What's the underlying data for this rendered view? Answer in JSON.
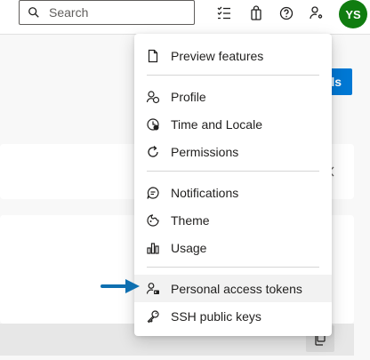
{
  "header": {
    "search_placeholder": "Search",
    "avatar_initials": "YS",
    "avatar_color": "#107c10",
    "icons": [
      "search-icon",
      "task-list-icon",
      "marketplace-bag-icon",
      "help-icon",
      "user-settings-icon"
    ]
  },
  "background": {
    "primary_button_label": "ls",
    "accent_color": "#0078d4"
  },
  "menu": {
    "items": [
      {
        "label": "Preview features",
        "icon": "preview-features-icon"
      },
      {
        "label": "Profile",
        "icon": "profile-icon"
      },
      {
        "label": "Time and Locale",
        "icon": "time-locale-icon"
      },
      {
        "label": "Permissions",
        "icon": "permissions-icon"
      },
      {
        "label": "Notifications",
        "icon": "notifications-icon"
      },
      {
        "label": "Theme",
        "icon": "theme-icon"
      },
      {
        "label": "Usage",
        "icon": "usage-icon"
      },
      {
        "label": "Personal access tokens",
        "icon": "personal-access-tokens-icon"
      },
      {
        "label": "SSH public keys",
        "icon": "ssh-keys-icon"
      }
    ],
    "highlighted_item": "Personal access tokens",
    "pointer_color": "#0e6fb0"
  }
}
